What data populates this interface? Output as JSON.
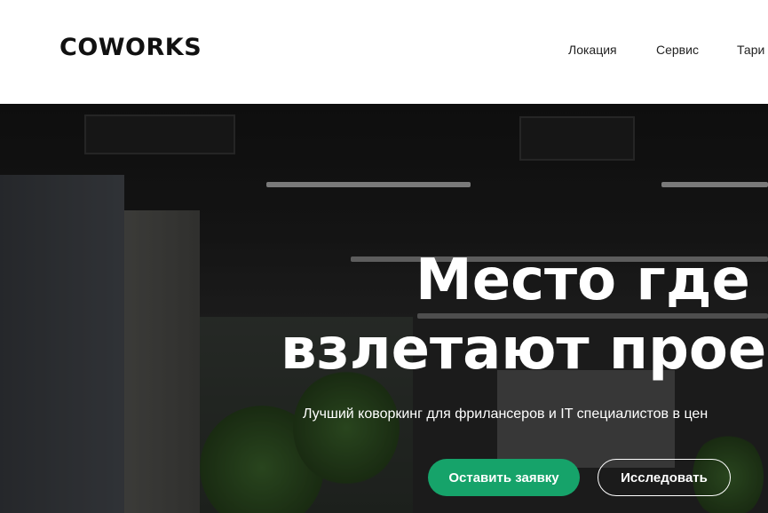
{
  "header": {
    "logo": "COWORKS",
    "nav": [
      "Локация",
      "Сервис",
      "Тари"
    ]
  },
  "hero": {
    "title_line1": "Место где",
    "title_line2": "взлетают прое",
    "subtitle": "Лучший коворкинг для фрилансеров и IT специалистов в цен",
    "primary_button": "Оставить заявку",
    "secondary_button": "Исследовать"
  },
  "colors": {
    "accent": "#16a36a",
    "header_bg": "#ffffff",
    "text_dark": "#111111"
  }
}
